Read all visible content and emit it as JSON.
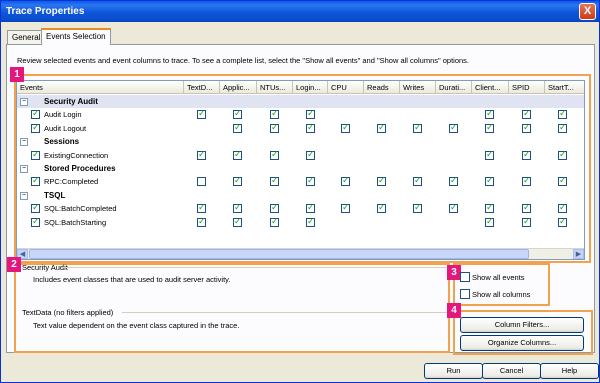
{
  "window": {
    "title": "Trace Properties",
    "close_glyph": "X"
  },
  "tabs": [
    {
      "label": "General",
      "active": false
    },
    {
      "label": "Events Selection",
      "active": true
    }
  ],
  "intro_text": "Review selected events and event columns to trace. To see a complete list, select the \"Show all events\" and \"Show all columns\" options.",
  "grid": {
    "columns": [
      "Events",
      "TextD...",
      "Applic...",
      "NTUs...",
      "Login...",
      "CPU",
      "Reads",
      "Writes",
      "Durati...",
      "Client...",
      "SPID",
      "StartT..."
    ],
    "rows": [
      {
        "type": "category",
        "label": "Security Audit",
        "selected": true
      },
      {
        "type": "event",
        "label": "Audit Login",
        "checked": true,
        "cells": [
          "on",
          "on",
          "on",
          "on",
          "",
          "",
          "",
          "",
          "on",
          "on",
          "on"
        ]
      },
      {
        "type": "event",
        "label": "Audit Logout",
        "checked": true,
        "cells": [
          "",
          "on",
          "on",
          "on",
          "on",
          "on",
          "on",
          "on",
          "on",
          "on",
          "on"
        ]
      },
      {
        "type": "category",
        "label": "Sessions"
      },
      {
        "type": "event",
        "label": "ExistingConnection",
        "checked": true,
        "cells": [
          "on",
          "on",
          "on",
          "on",
          "",
          "",
          "",
          "",
          "on",
          "on",
          "on"
        ]
      },
      {
        "type": "category",
        "label": "Stored Procedures"
      },
      {
        "type": "event",
        "label": "RPC:Completed",
        "checked": true,
        "cells": [
          "off",
          "on",
          "on",
          "on",
          "on",
          "on",
          "on",
          "on",
          "on",
          "on",
          "on"
        ]
      },
      {
        "type": "category",
        "label": "TSQL"
      },
      {
        "type": "event",
        "label": "SQL:BatchCompleted",
        "checked": true,
        "cells": [
          "on",
          "on",
          "on",
          "on",
          "on",
          "on",
          "on",
          "on",
          "on",
          "on",
          "on"
        ]
      },
      {
        "type": "event",
        "label": "SQL:BatchStarting",
        "checked": true,
        "cells": [
          "on",
          "on",
          "on",
          "on",
          "",
          "",
          "",
          "",
          "on",
          "on",
          "on"
        ]
      }
    ]
  },
  "badges": [
    "1",
    "2",
    "3",
    "4"
  ],
  "event_info": {
    "title": "Security Audit",
    "description": "Includes event classes that are used to audit server activity."
  },
  "column_info": {
    "title": "TextData (no filters applied)",
    "description": "Text value dependent on the event class captured in the trace."
  },
  "options": {
    "show_all_events": "Show all events",
    "show_all_columns": "Show all columns"
  },
  "buttons": {
    "column_filters": "Column Filters...",
    "organize_columns": "Organize Columns...",
    "run": "Run",
    "cancel": "Cancel",
    "help": "Help"
  },
  "colors": {
    "title_bar": "#0a5de9",
    "annotation_border": "#f2a14e",
    "annotation_badge": "#e4177f",
    "check": "#21a121"
  }
}
